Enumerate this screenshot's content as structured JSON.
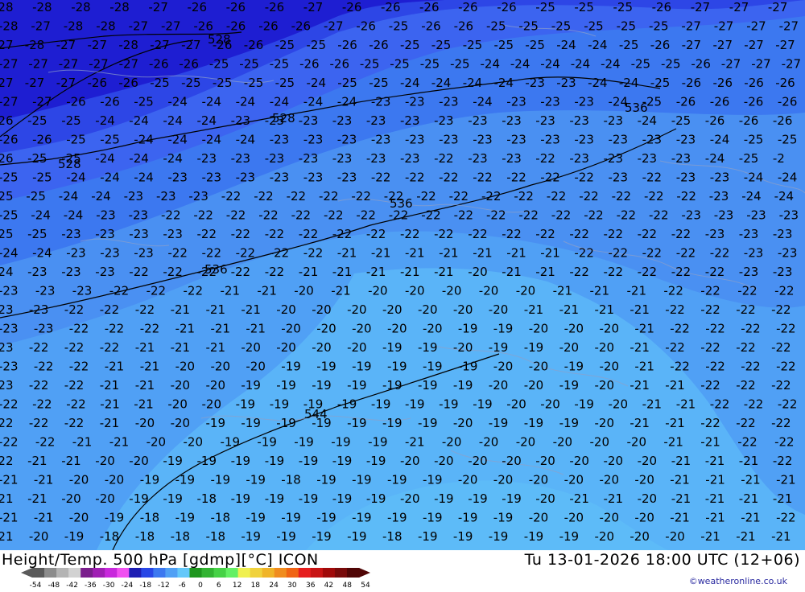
{
  "header": {
    "title": "Height/Temp. 500 hPa [gdmp][°C] ICON",
    "datetime": "Tu 13-01-2026 18:00 UTC (12+06)",
    "credit": "©weatheronline.co.uk"
  },
  "legend": {
    "ticks": [
      "-54",
      "-48",
      "-42",
      "-36",
      "-30",
      "-24",
      "-18",
      "-12",
      "-6",
      "0",
      "6",
      "12",
      "18",
      "24",
      "30",
      "36",
      "42",
      "48",
      "54"
    ],
    "colors": [
      "#5a5a5a",
      "#8c8c8c",
      "#b4b4b4",
      "#d2d2d2",
      "#7a1e8c",
      "#a01eb4",
      "#c828dc",
      "#f050f0",
      "#1e1eb4",
      "#2846e6",
      "#3c78f0",
      "#50a0f5",
      "#64c8fa",
      "#1e961e",
      "#32b432",
      "#46d246",
      "#64f064",
      "#f0f050",
      "#f0d23c",
      "#f0b428",
      "#f08c1e",
      "#f06414",
      "#e61e1e",
      "#c81414",
      "#a00a0a",
      "#780a0a",
      "#500505"
    ]
  },
  "map": {
    "height_labels": [
      "528",
      "528",
      "528",
      "536",
      "536",
      "536",
      "544"
    ],
    "temperature_rows": [
      {
        "values": [
          "-28",
          "-28",
          "-28",
          "-28",
          "-27",
          "-26",
          "-26",
          "-26",
          "-27",
          "-26",
          "-26",
          "-26",
          "-26",
          "-26",
          "-25",
          "-25",
          "-25",
          "-26",
          "-27",
          "-27",
          "-27"
        ]
      },
      {
        "values": [
          "-28",
          "-27",
          "-28",
          "-28",
          "-27",
          "-27",
          "-26",
          "-26",
          "-26",
          "-26",
          "-27",
          "-26",
          "-25",
          "-26",
          "-26",
          "-25",
          "-25",
          "-25",
          "-25",
          "-25",
          "-25",
          "-27",
          "-27",
          "-27",
          "-27"
        ]
      },
      {
        "values": [
          "-27",
          "-28",
          "-27",
          "-27",
          "-28",
          "-27",
          "-27",
          "-26",
          "-26",
          "-25",
          "-25",
          "-26",
          "-26",
          "-25",
          "-25",
          "-25",
          "-25",
          "-25",
          "-24",
          "-24",
          "-25",
          "-26",
          "-27",
          "-27",
          "-27",
          "-27"
        ]
      },
      {
        "values": [
          "-27",
          "-27",
          "-27",
          "-27",
          "-27",
          "-26",
          "-26",
          "-25",
          "-25",
          "-25",
          "-26",
          "-26",
          "-25",
          "-25",
          "-25",
          "-25",
          "-24",
          "-24",
          "-24",
          "-24",
          "-24",
          "-25",
          "-25",
          "-26",
          "-27",
          "-27",
          "-27"
        ]
      },
      {
        "values": [
          "-27",
          "-27",
          "-27",
          "-26",
          "-26",
          "-25",
          "-25",
          "-25",
          "-25",
          "-25",
          "-24",
          "-25",
          "-25",
          "-24",
          "-24",
          "-24",
          "-24",
          "-23",
          "-23",
          "-24",
          "-24",
          "-25",
          "-26",
          "-26",
          "-26",
          "-26"
        ]
      },
      {
        "values": [
          "-27",
          "-27",
          "-26",
          "-26",
          "-25",
          "-24",
          "-24",
          "-24",
          "-24",
          "-24",
          "-24",
          "-23",
          "-23",
          "-23",
          "-24",
          "-23",
          "-23",
          "-23",
          "-24",
          "-25",
          "-26",
          "-26",
          "-26",
          "-26"
        ]
      },
      {
        "values": [
          "-26",
          "-25",
          "-25",
          "-24",
          "-24",
          "-24",
          "-24",
          "-23",
          "-23",
          "-23",
          "-23",
          "-23",
          "-23",
          "-23",
          "-23",
          "-23",
          "-23",
          "-23",
          "-23",
          "-24",
          "-25",
          "-26",
          "-26",
          "-26"
        ]
      },
      {
        "values": [
          "-26",
          "-26",
          "-25",
          "-25",
          "-24",
          "-24",
          "-24",
          "-24",
          "-23",
          "-23",
          "-23",
          "-23",
          "-23",
          "-23",
          "-23",
          "-23",
          "-23",
          "-23",
          "-23",
          "-23",
          "-23",
          "-24",
          "-25",
          "-25"
        ]
      },
      {
        "values": [
          "-26",
          "-25",
          "-25",
          "-24",
          "-24",
          "-24",
          "-23",
          "-23",
          "-23",
          "-23",
          "-23",
          "-23",
          "-23",
          "-22",
          "-23",
          "-23",
          "-22",
          "-23",
          "-23",
          "-23",
          "-23",
          "-24",
          "-25",
          "-2"
        ]
      },
      {
        "values": [
          "-25",
          "-25",
          "-24",
          "-24",
          "-24",
          "-23",
          "-23",
          "-23",
          "-23",
          "-23",
          "-23",
          "-22",
          "-22",
          "-22",
          "-22",
          "-22",
          "-22",
          "-22",
          "-23",
          "-22",
          "-23",
          "-23",
          "-24",
          "-24"
        ]
      },
      {
        "values": [
          "-25",
          "-25",
          "-24",
          "-24",
          "-23",
          "-23",
          "-23",
          "-22",
          "-22",
          "-22",
          "-22",
          "-22",
          "-22",
          "-22",
          "-22",
          "-22",
          "-22",
          "-22",
          "-22",
          "-22",
          "-22",
          "-22",
          "-23",
          "-24",
          "-24"
        ]
      },
      {
        "values": [
          "-25",
          "-24",
          "-24",
          "-23",
          "-23",
          "-22",
          "-22",
          "-22",
          "-22",
          "-22",
          "-22",
          "-22",
          "-22",
          "-22",
          "-22",
          "-22",
          "-22",
          "-22",
          "-22",
          "-22",
          "-22",
          "-23",
          "-23",
          "-23",
          "-23"
        ]
      },
      {
        "values": [
          "-25",
          "-25",
          "-23",
          "-23",
          "-23",
          "-23",
          "-22",
          "-22",
          "-22",
          "-22",
          "-22",
          "-22",
          "-22",
          "-22",
          "-22",
          "-22",
          "-22",
          "-22",
          "-22",
          "-22",
          "-22",
          "-23",
          "-23",
          "-23"
        ]
      },
      {
        "values": [
          "-24",
          "-24",
          "-23",
          "-23",
          "-23",
          "-22",
          "-22",
          "-22",
          "-22",
          "-22",
          "-21",
          "-21",
          "-21",
          "-21",
          "-21",
          "-21",
          "-21",
          "-22",
          "-22",
          "-22",
          "-22",
          "-22",
          "-23",
          "-23"
        ]
      },
      {
        "values": [
          "-24",
          "-23",
          "-23",
          "-23",
          "-22",
          "-22",
          "-22",
          "-22",
          "-22",
          "-21",
          "-21",
          "-21",
          "-21",
          "-21",
          "-20",
          "-21",
          "-21",
          "-22",
          "-22",
          "-22",
          "-22",
          "-22",
          "-23",
          "-23"
        ]
      },
      {
        "values": [
          "-23",
          "-23",
          "-23",
          "-22",
          "-22",
          "-22",
          "-21",
          "-21",
          "-20",
          "-21",
          "-20",
          "-20",
          "-20",
          "-20",
          "-20",
          "-21",
          "-21",
          "-21",
          "-22",
          "-22",
          "-22",
          "-22"
        ]
      },
      {
        "values": [
          "-23",
          "-23",
          "-22",
          "-22",
          "-22",
          "-21",
          "-21",
          "-21",
          "-20",
          "-20",
          "-20",
          "-20",
          "-20",
          "-20",
          "-20",
          "-21",
          "-21",
          "-21",
          "-21",
          "-22",
          "-22",
          "-22",
          "-22"
        ]
      },
      {
        "values": [
          "-23",
          "-23",
          "-22",
          "-22",
          "-22",
          "-21",
          "-21",
          "-21",
          "-20",
          "-20",
          "-20",
          "-20",
          "-20",
          "-19",
          "-19",
          "-20",
          "-20",
          "-20",
          "-21",
          "-22",
          "-22",
          "-22",
          "-22"
        ]
      },
      {
        "values": [
          "-23",
          "-22",
          "-22",
          "-22",
          "-21",
          "-21",
          "-21",
          "-20",
          "-20",
          "-20",
          "-20",
          "-19",
          "-19",
          "-20",
          "-19",
          "-19",
          "-20",
          "-20",
          "-21",
          "-22",
          "-22",
          "-22",
          "-22"
        ]
      },
      {
        "values": [
          "-23",
          "-22",
          "-22",
          "-21",
          "-21",
          "-20",
          "-20",
          "-20",
          "-19",
          "-19",
          "-19",
          "-19",
          "-19",
          "-19",
          "-20",
          "-20",
          "-19",
          "-20",
          "-21",
          "-22",
          "-22",
          "-22",
          "-22"
        ]
      },
      {
        "values": [
          "-23",
          "-22",
          "-22",
          "-21",
          "-21",
          "-20",
          "-20",
          "-19",
          "-19",
          "-19",
          "-19",
          "-19",
          "-19",
          "-19",
          "-20",
          "-20",
          "-19",
          "-20",
          "-21",
          "-21",
          "-22",
          "-22",
          "-22"
        ]
      },
      {
        "values": [
          "-22",
          "-22",
          "-22",
          "-21",
          "-21",
          "-20",
          "-20",
          "-19",
          "-19",
          "-19",
          "-19",
          "-19",
          "-19",
          "-19",
          "-19",
          "-20",
          "-20",
          "-19",
          "-20",
          "-21",
          "-21",
          "-22",
          "-22",
          "-22"
        ]
      },
      {
        "values": [
          "-22",
          "-22",
          "-22",
          "-21",
          "-20",
          "-20",
          "-19",
          "-19",
          "-19",
          "-19",
          "-19",
          "-19",
          "-19",
          "-20",
          "-19",
          "-19",
          "-19",
          "-20",
          "-21",
          "-21",
          "-22",
          "-22",
          "-22"
        ]
      },
      {
        "values": [
          "-22",
          "-22",
          "-21",
          "-21",
          "-20",
          "-20",
          "-19",
          "-19",
          "-19",
          "-19",
          "-19",
          "-21",
          "-20",
          "-20",
          "-20",
          "-20",
          "-20",
          "-20",
          "-21",
          "-21",
          "-22",
          "-22"
        ]
      },
      {
        "values": [
          "-22",
          "-21",
          "-21",
          "-20",
          "-20",
          "-19",
          "-19",
          "-19",
          "-19",
          "-19",
          "-19",
          "-19",
          "-20",
          "-20",
          "-20",
          "-20",
          "-20",
          "-20",
          "-20",
          "-20",
          "-21",
          "-21",
          "-21",
          "-22"
        ]
      },
      {
        "values": [
          "-21",
          "-21",
          "-20",
          "-20",
          "-19",
          "-19",
          "-19",
          "-19",
          "-18",
          "-19",
          "-19",
          "-19",
          "-19",
          "-20",
          "-20",
          "-20",
          "-20",
          "-20",
          "-20",
          "-21",
          "-21",
          "-21",
          "-21"
        ]
      },
      {
        "values": [
          "-21",
          "-21",
          "-20",
          "-20",
          "-19",
          "-19",
          "-18",
          "-19",
          "-19",
          "-19",
          "-19",
          "-19",
          "-20",
          "-19",
          "-19",
          "-19",
          "-20",
          "-21",
          "-21",
          "-20",
          "-21",
          "-21",
          "-21",
          "-21"
        ]
      },
      {
        "values": [
          "-21",
          "-21",
          "-20",
          "-19",
          "-18",
          "-19",
          "-18",
          "-19",
          "-19",
          "-19",
          "-19",
          "-19",
          "-19",
          "-19",
          "-19",
          "-20",
          "-20",
          "-20",
          "-20",
          "-21",
          "-21",
          "-21",
          "-22"
        ]
      },
      {
        "values": [
          "-21",
          "-20",
          "-19",
          "-18",
          "-18",
          "-18",
          "-18",
          "-19",
          "-19",
          "-19",
          "-19",
          "-18",
          "-19",
          "-19",
          "-19",
          "-19",
          "-19",
          "-20",
          "-20",
          "-20",
          "-21",
          "-21",
          "-21"
        ]
      }
    ]
  }
}
